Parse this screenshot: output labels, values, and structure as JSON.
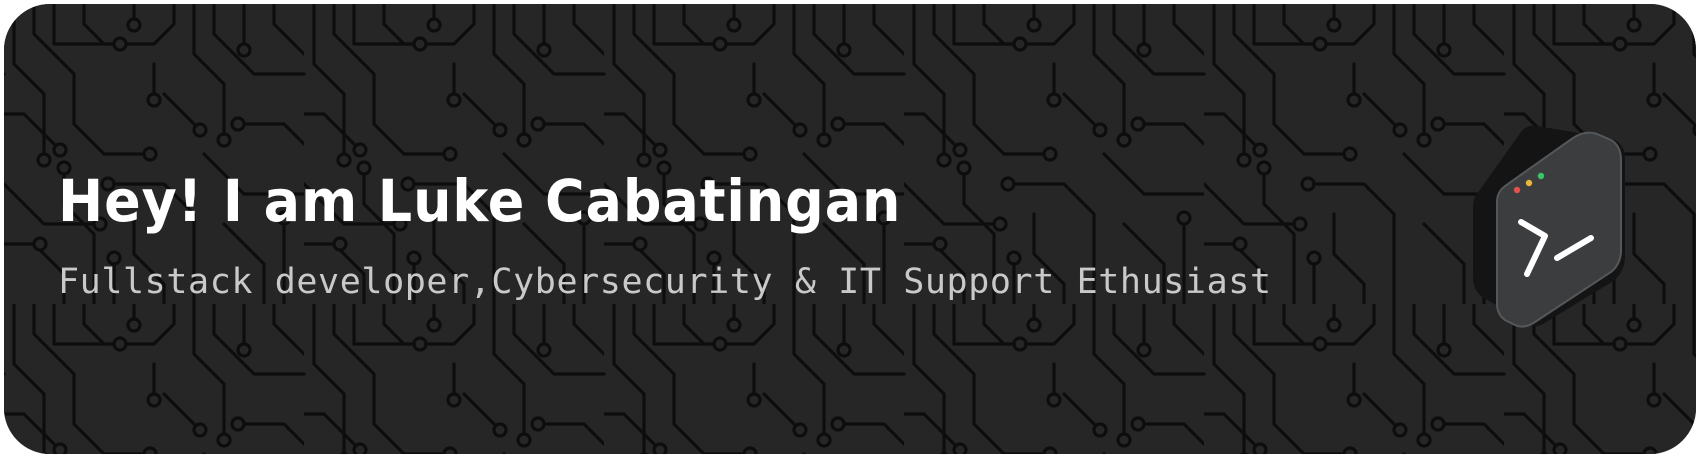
{
  "banner": {
    "title": "Hey! I am Luke Cabatingan",
    "subtitle": "Fullstack developer,Cybersecurity & IT Support Ethusiast",
    "background_color": "#262626",
    "pattern_color": "#0d0d0d",
    "badge": {
      "icon": "terminal-icon",
      "dot_colors": [
        "#e0524a",
        "#e8b63a",
        "#3cc46b"
      ]
    }
  }
}
